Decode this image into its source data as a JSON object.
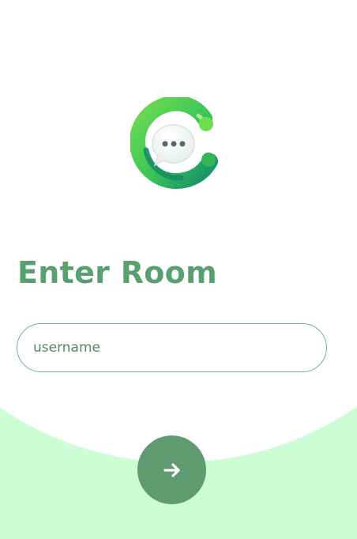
{
  "screen": {
    "title": "Enter Room",
    "username_input": {
      "placeholder": "username",
      "value": ""
    },
    "submit_button": {
      "icon": "arrow-right-icon"
    },
    "logo": {
      "icon": "chat-bubble-logo-icon"
    }
  },
  "colors": {
    "background": "#ccfdd5",
    "panel": "#ffffff",
    "title": "#5aa06f",
    "input_border": "#6fb27f",
    "button": "#5e9b6f",
    "logo_green": "#4fc24f",
    "logo_dark_green": "#1f9a67"
  }
}
